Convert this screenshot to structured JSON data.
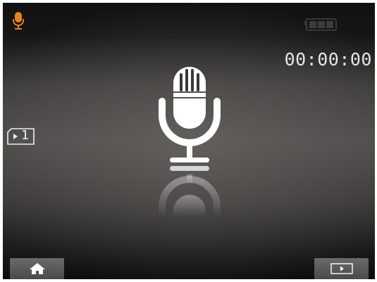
{
  "status_bar": {
    "mode_icon": "microphone-icon",
    "mode_icon_color": "#e8801e",
    "battery_icon": "battery-icon"
  },
  "recording": {
    "elapsed_time": "00:00:00"
  },
  "file_slot": {
    "icon": "file-slot-icon",
    "number": "1"
  },
  "center_graphic": {
    "icon": "microphone-icon"
  },
  "bottom_bar": {
    "left_button_icon": "home-icon",
    "right_button_icon": "play-icon"
  },
  "colors": {
    "accent": "#e8801e",
    "text": "#e6e6e6"
  }
}
